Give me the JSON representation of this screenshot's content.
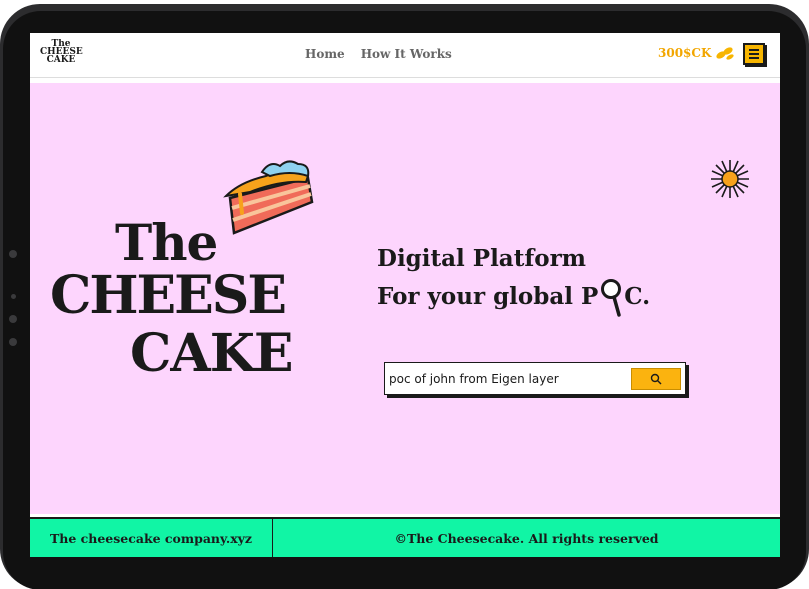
{
  "header": {
    "logo_line1": "The",
    "logo_line2": "CHEESE",
    "logo_line3": "CAKE",
    "nav": [
      {
        "label": "Home"
      },
      {
        "label": "How It Works"
      }
    ],
    "balance": "300$CK",
    "menu_icon": "hamburger-menu-icon"
  },
  "hero": {
    "logo_the": "The",
    "logo_cheese": "CHEESE",
    "logo_cake": "CAKE",
    "tagline_line1": "Digital Platform",
    "tagline_line2_a": "For your global P",
    "tagline_line2_b": "C.",
    "search": {
      "value": "poc of john from Eigen layer",
      "button_icon": "search-icon"
    }
  },
  "footer": {
    "left": "The cheesecake company.xyz",
    "right": "©The Cheesecake. All rights reserved"
  },
  "colors": {
    "hero_bg": "#fdd5fd",
    "footer_bg": "#11f5a5",
    "accent": "#fbb30f"
  }
}
